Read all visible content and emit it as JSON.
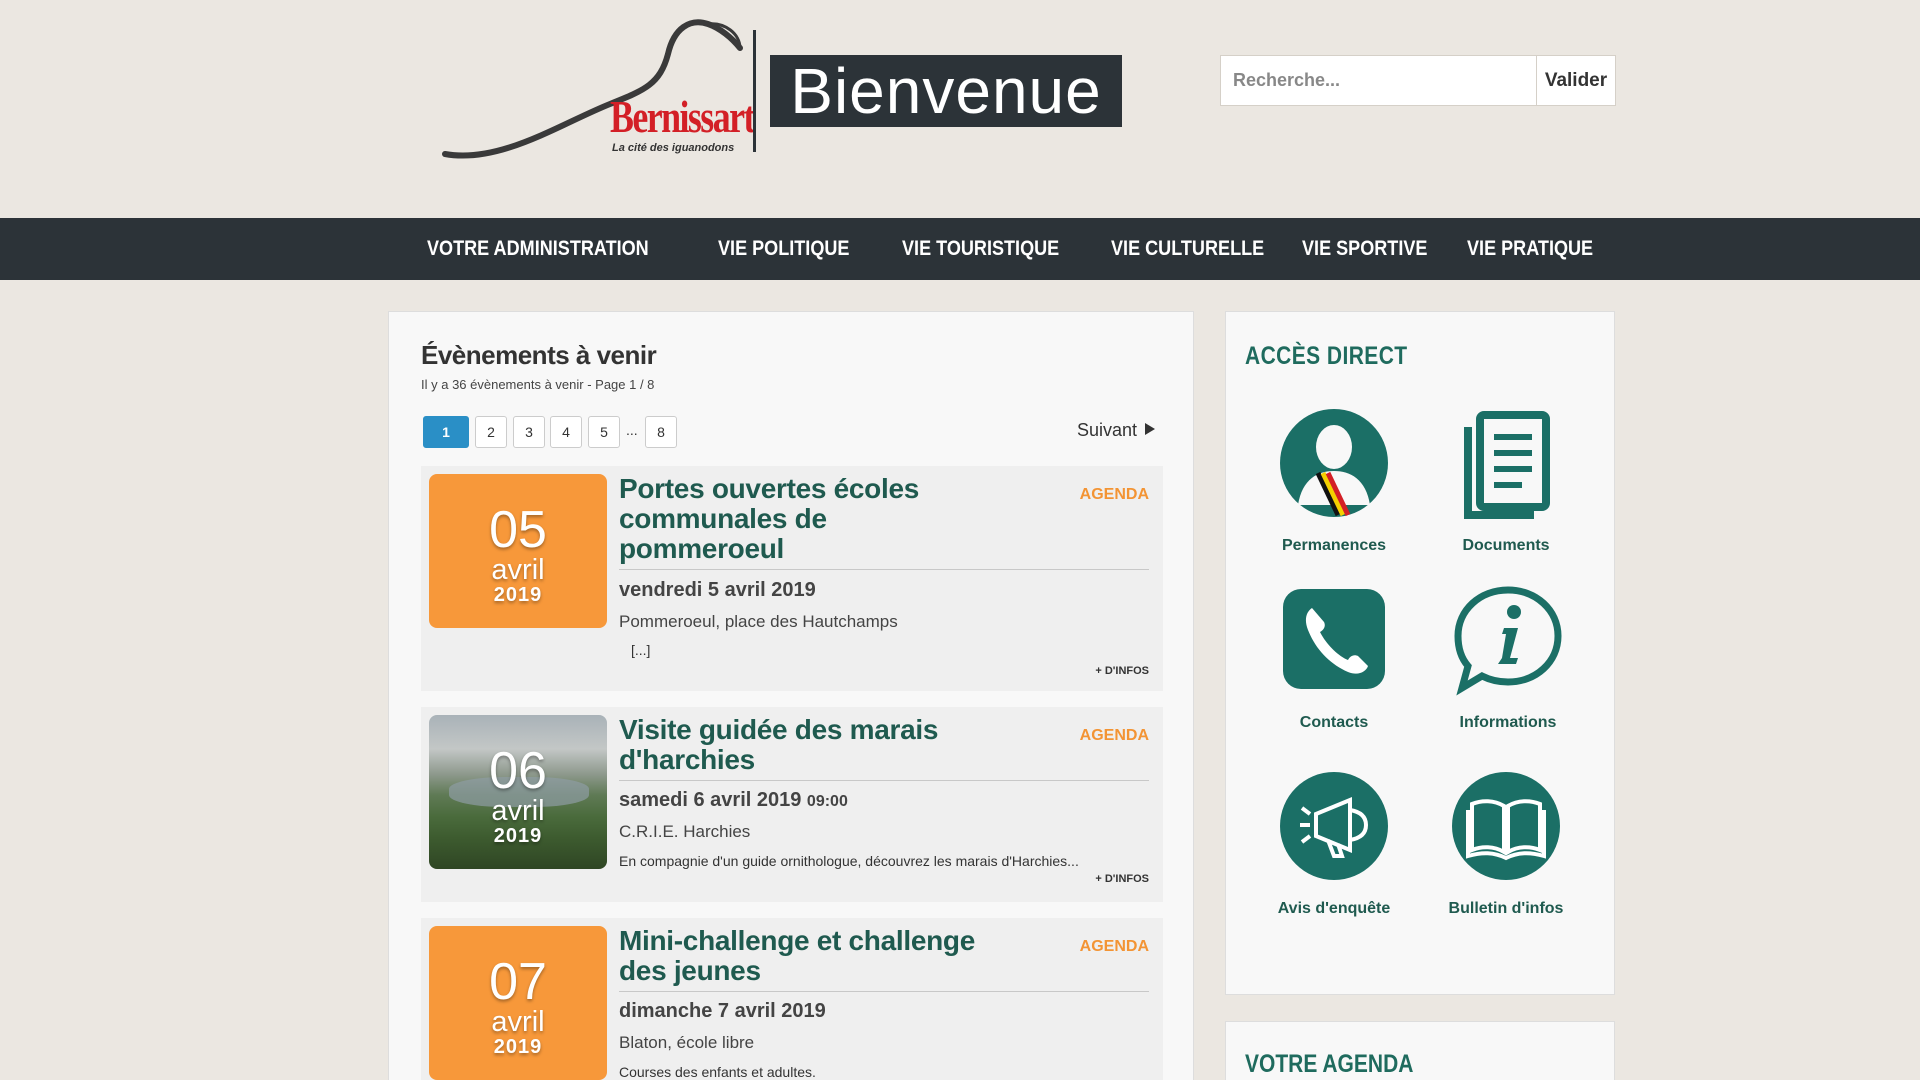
{
  "header": {
    "logo_name": "Bernissart",
    "logo_tagline": "La cité des iguanodons",
    "welcome": "Bienvenue",
    "search_placeholder": "Recherche...",
    "search_button": "Valider"
  },
  "nav": [
    {
      "label": "VOTRE ADMINISTRATION"
    },
    {
      "label": "VIE POLITIQUE"
    },
    {
      "label": "VIE TOURISTIQUE"
    },
    {
      "label": "VIE CULTURELLE"
    },
    {
      "label": "VIE SPORTIVE"
    },
    {
      "label": "VIE PRATIQUE"
    }
  ],
  "events_section": {
    "title": "Évènements à venir",
    "subtitle": "Il y a 36 évènements à venir - Page 1 / 8",
    "pages": [
      "1",
      "2",
      "3",
      "4",
      "5",
      "8"
    ],
    "ellipsis": "...",
    "current_page": "1",
    "next_label": "Suivant"
  },
  "events": [
    {
      "day": "05",
      "month": "avril",
      "year": "2019",
      "title": "Portes ouvertes écoles communales de pommeroeul",
      "tag": "AGENDA",
      "date_text": "vendredi 5 avril 2019",
      "time": "",
      "place": "Pommeroeul, place des Hautchamps",
      "description": "[...]",
      "more": "+ D'INFOS"
    },
    {
      "day": "06",
      "month": "avril",
      "year": "2019",
      "title": "Visite guidée des marais d'harchies",
      "tag": "AGENDA",
      "date_text": "samedi 6 avril 2019",
      "time": "09:00",
      "place": "C.R.I.E. Harchies",
      "description": "En compagnie d'un guide ornithologue, découvrez les marais d'Harchies...",
      "more": "+ D'INFOS"
    },
    {
      "day": "07",
      "month": "avril",
      "year": "2019",
      "title": "Mini-challenge et challenge des jeunes",
      "tag": "AGENDA",
      "date_text": "dimanche 7 avril 2019",
      "time": "",
      "place": "Blaton, école libre",
      "description": "Courses des enfants et adultes.",
      "more": ""
    }
  ],
  "sidebar": {
    "title": "ACCÈS DIRECT",
    "items": [
      {
        "label": "Permanences",
        "icon": "person-icon"
      },
      {
        "label": "Documents",
        "icon": "documents-icon"
      },
      {
        "label": "Contacts",
        "icon": "phone-icon"
      },
      {
        "label": "Informations",
        "icon": "info-icon"
      },
      {
        "label": "Avis d'enquête",
        "icon": "megaphone-icon"
      },
      {
        "label": "Bulletin d'infos",
        "icon": "book-icon"
      }
    ],
    "agenda_title": "VOTRE AGENDA"
  },
  "colors": {
    "nav_bg": "#2c3338",
    "accent_orange": "#f7983a",
    "title_green": "#1f5a4f",
    "icon_teal": "#1b6f66",
    "page_active": "#2a8fc6",
    "brand_red": "#d31f26"
  }
}
